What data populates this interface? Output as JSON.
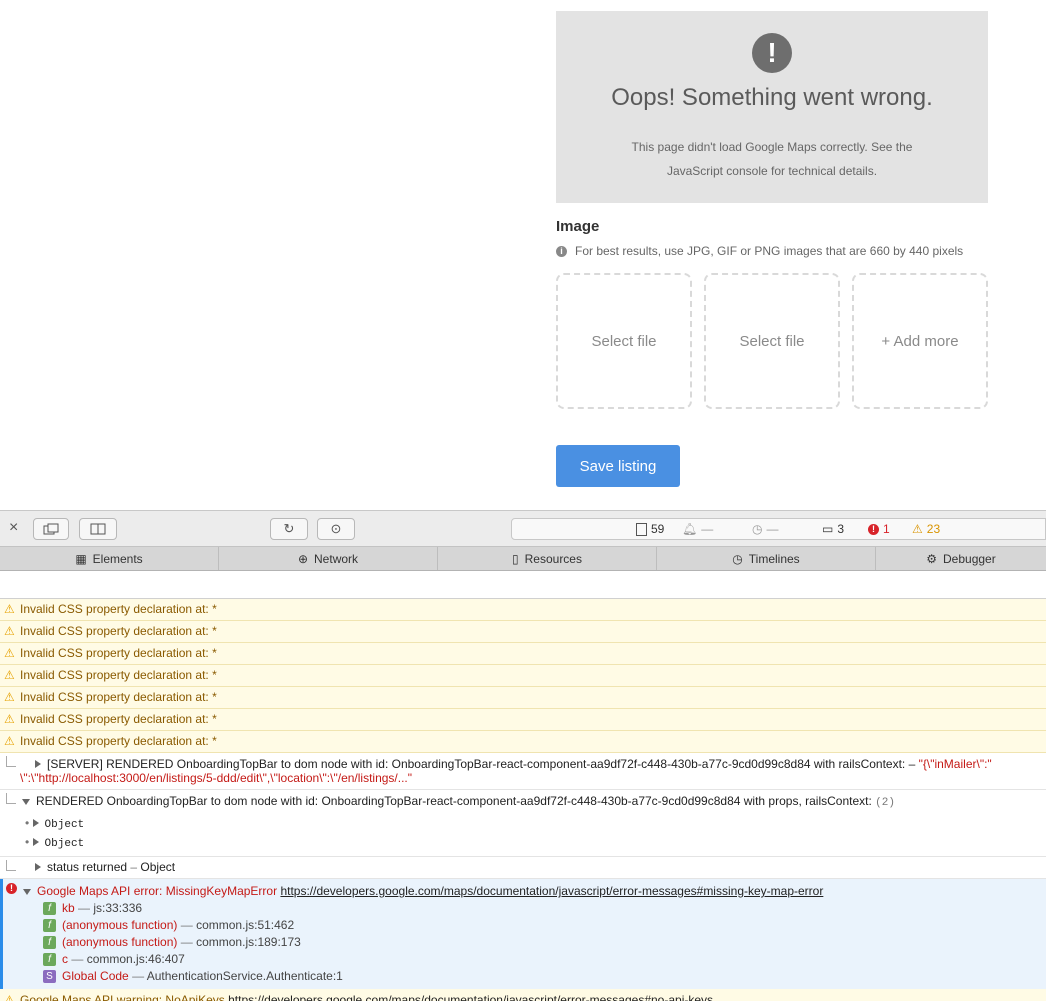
{
  "map_error": {
    "icon": "!",
    "title": "Oops! Something went wrong.",
    "message_line1": "This page didn't load Google Maps correctly. See the",
    "message_line2": "JavaScript console for technical details."
  },
  "image_section": {
    "heading": "Image",
    "hint": "For best results, use JPG, GIF or PNG images that are 660 by 440 pixels",
    "slots": [
      "Select file",
      "Select file",
      "+ Add more"
    ]
  },
  "save_label": "Save listing",
  "devtools": {
    "status": {
      "resources": "59",
      "bell": "—",
      "clock": "—",
      "logs": "3",
      "errors": "1",
      "warnings": "23"
    },
    "tabs": [
      "Elements",
      "Network",
      "Resources",
      "Timelines",
      "Debugger"
    ],
    "console": {
      "warn_text": "Invalid CSS property declaration at: *",
      "server_log_1": "[SERVER] RENDERED OnboardingTopBar to dom node with id: OnboardingTopBar-react-component-aa9df72f-c448-430b-a77c-9cd0d99c8d84 with railsContext: –",
      "server_log_str": "\"{\\\"inMailer\\\":\"",
      "server_log_2": "\\\":\\\"http://localhost:3000/en/listings/5-ddd/edit\\\",\\\"location\\\":\\\"/en/listings/...\"",
      "rendered_log": "RENDERED OnboardingTopBar to dom node with id: OnboardingTopBar-react-component-aa9df72f-c448-430b-a77c-9cd0d99c8d84 with props, railsContext:",
      "rendered_count": "(2)",
      "object_1": "Object",
      "object_2": "Object",
      "status_log": "status returned",
      "status_obj": "Object",
      "error_label": "Google Maps API error: MissingKeyMapError",
      "error_url": "https://developers.google.com/maps/documentation/javascript/error-messages#missing-key-map-error",
      "frames": [
        {
          "badge": "f",
          "name": "kb",
          "loc": "js:33:336"
        },
        {
          "badge": "f",
          "name": "(anonymous function)",
          "loc": "common.js:51:462"
        },
        {
          "badge": "f",
          "name": "(anonymous function)",
          "loc": "common.js:189:173"
        },
        {
          "badge": "f",
          "name": "c",
          "loc": "common.js:46:407"
        },
        {
          "badge": "S",
          "name": "Global Code",
          "loc": "AuthenticationService.Authenticate:1"
        }
      ],
      "warning_label": "Google Maps API warning: NoApiKeys",
      "warning_url": "https://developers.google.com/maps/documentation/javascript/error-messages#no-api-keys"
    }
  }
}
